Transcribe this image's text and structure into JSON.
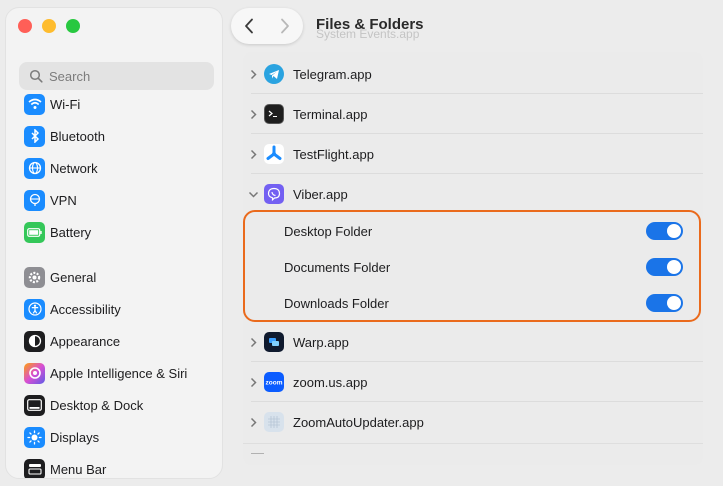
{
  "window": {
    "title": "Files & Folders",
    "ghost_header": "System Events.app"
  },
  "sidebar": {
    "search_placeholder": "Search",
    "items": [
      {
        "label": "Wi-Fi",
        "icon": "wifi-icon",
        "color": "#1a8cff"
      },
      {
        "label": "Bluetooth",
        "icon": "bluetooth-icon",
        "color": "#1a8cff"
      },
      {
        "label": "Network",
        "icon": "globe-icon",
        "color": "#1a8cff"
      },
      {
        "label": "VPN",
        "icon": "vpn-globe-icon",
        "color": "#1a8cff"
      },
      {
        "label": "Battery",
        "icon": "battery-icon",
        "color": "#34c759"
      },
      {
        "label": "General",
        "icon": "gear-icon",
        "color": "#8e8e93"
      },
      {
        "label": "Accessibility",
        "icon": "accessibility-icon",
        "color": "#1a8cff"
      },
      {
        "label": "Appearance",
        "icon": "appearance-icon",
        "color": "#1d1d1f"
      },
      {
        "label": "Apple Intelligence & Siri",
        "icon": "siri-icon",
        "color": "#d84fd3"
      },
      {
        "label": "Desktop & Dock",
        "icon": "dock-icon",
        "color": "#1d1d1f"
      },
      {
        "label": "Displays",
        "icon": "sun-icon",
        "color": "#1a8cff"
      },
      {
        "label": "Menu Bar",
        "icon": "menubar-icon",
        "color": "#1d1d1f"
      }
    ]
  },
  "apps": {
    "telegram": "Telegram.app",
    "terminal": "Terminal.app",
    "testflight": "TestFlight.app",
    "viber": "Viber.app",
    "warp": "Warp.app",
    "zoom": "zoom.us.app",
    "zoomupdater": "ZoomAutoUpdater.app"
  },
  "viber_permissions": [
    {
      "label": "Desktop Folder",
      "enabled": true
    },
    {
      "label": "Documents Folder",
      "enabled": true
    },
    {
      "label": "Downloads Folder",
      "enabled": true
    }
  ],
  "footer": {
    "minus": "—"
  },
  "colors": {
    "accent": "#1a74e8",
    "highlight": "#ea6a1c"
  }
}
